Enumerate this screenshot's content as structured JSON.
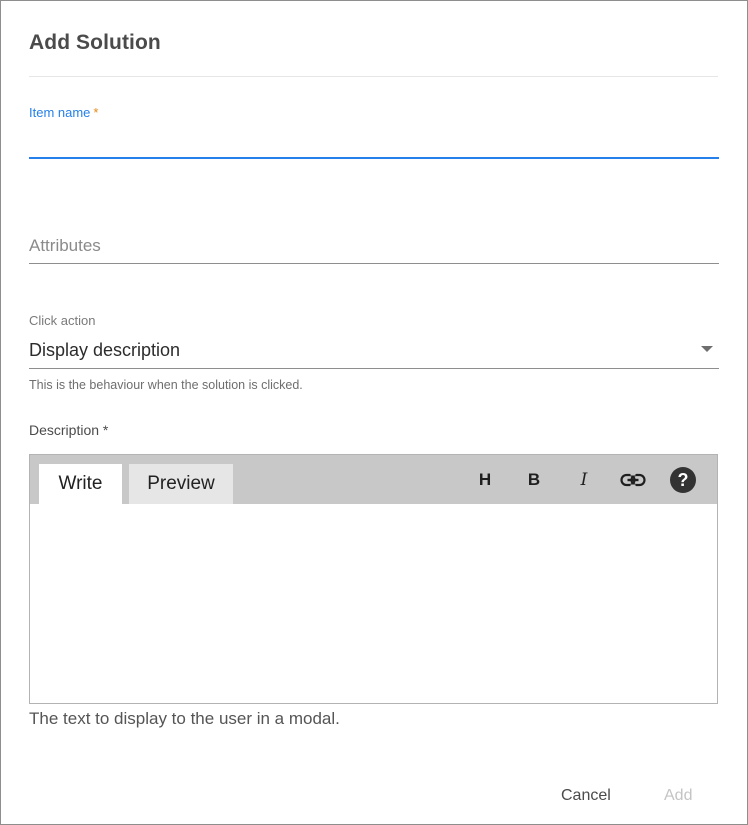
{
  "dialog": {
    "title": "Add Solution"
  },
  "item_name": {
    "label": "Item name",
    "required_mark": "*",
    "value": ""
  },
  "attributes": {
    "placeholder": "Attributes",
    "value": ""
  },
  "click_action": {
    "label": "Click action",
    "selected": "Display description",
    "help": "This is the behaviour when the solution is clicked.",
    "icon": "chevron-down-icon"
  },
  "description": {
    "label": "Description *",
    "tabs": [
      "Write",
      "Preview"
    ],
    "toolbar": {
      "heading": "H",
      "bold": "B",
      "italic": "I",
      "link_icon": "link-icon",
      "help": "?"
    },
    "value": "",
    "help": "The text to display to the user in a modal."
  },
  "buttons": {
    "cancel": "Cancel",
    "add": "Add"
  },
  "colors": {
    "accent": "#2680eb",
    "required": "#e68619",
    "toolbar_bg": "#c8c8c8",
    "disabled_text": "#c4c4c4"
  }
}
